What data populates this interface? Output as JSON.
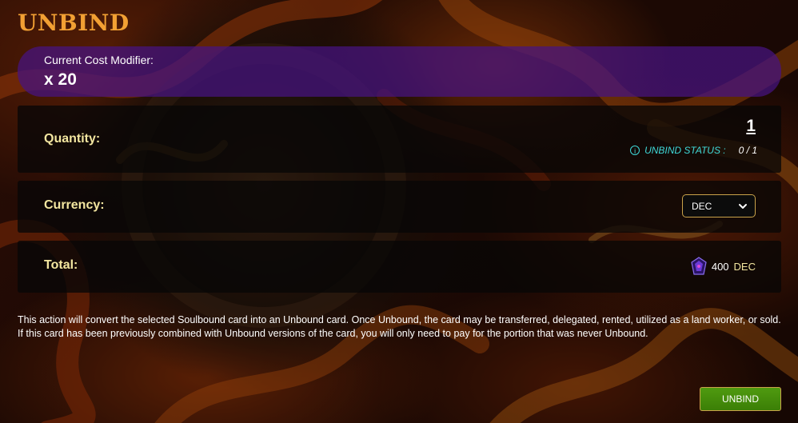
{
  "dialog": {
    "title": "UNBIND"
  },
  "cost_modifier": {
    "label": "Current Cost Modifier:",
    "value": "x 20"
  },
  "quantity": {
    "label": "Quantity:",
    "value": "1",
    "status_label": "UNBIND STATUS :",
    "status_count": "0 / 1",
    "status_icon": "info-icon"
  },
  "currency": {
    "label": "Currency:",
    "selected": "DEC",
    "icon": "chevron-down-icon"
  },
  "total": {
    "label": "Total:",
    "amount": "400",
    "unit": "DEC",
    "icon": "dec-token-icon"
  },
  "notice": "This action will convert the selected Soulbound card into an Unbound card. Once Unbound, the card may be transferred, delegated, rented, utilized as a land worker, or sold. If this card has been previously combined with Unbound versions of the card, you will only need to pay for the portion that was never Unbound.",
  "actions": {
    "unbind_label": "UNBIND"
  },
  "colors": {
    "title": "#f2a033",
    "cost_panel": "#46148c",
    "status": "#3fd9d9",
    "row_label": "#f3e6a0",
    "button": "#3b7f06",
    "button_border": "#c9a24a"
  }
}
